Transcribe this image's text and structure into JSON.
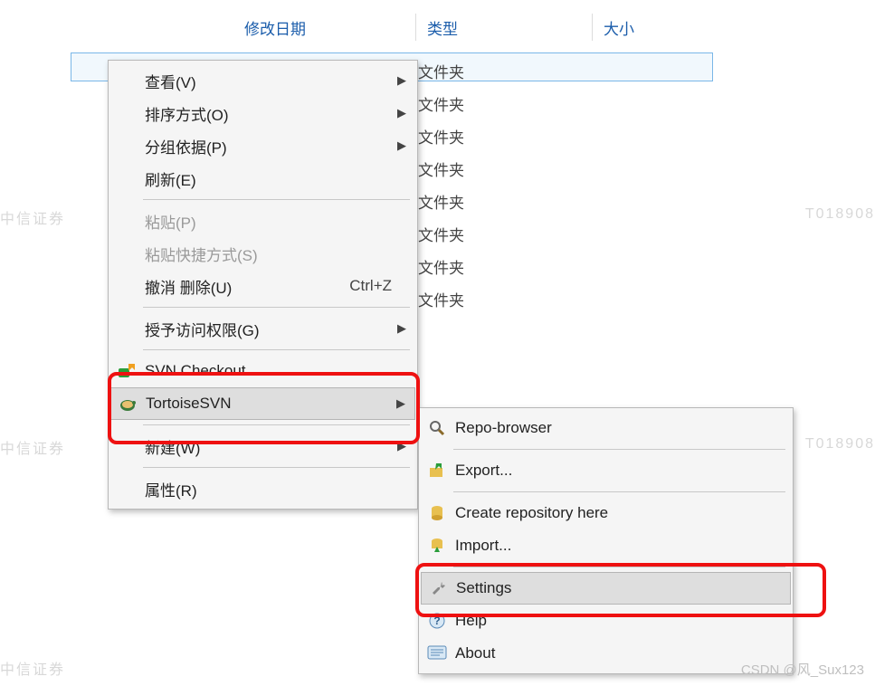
{
  "headers": {
    "date": "修改日期",
    "type": "类型",
    "size": "大小"
  },
  "rows": {
    "type_label": "文件夹",
    "count": 8
  },
  "menu1": {
    "view": "查看(V)",
    "sort": "排序方式(O)",
    "group": "分组依据(P)",
    "refresh": "刷新(E)",
    "paste": "粘贴(P)",
    "paste_shortcut": "粘贴快捷方式(S)",
    "undo_delete": "撤消 删除(U)",
    "undo_shortcut": "Ctrl+Z",
    "grant_access": "授予访问权限(G)",
    "svn_checkout": "SVN Checkout...",
    "tortoise": "TortoiseSVN",
    "new": "新建(W)",
    "properties": "属性(R)"
  },
  "menu2": {
    "repo_browser": "Repo-browser",
    "export": "Export...",
    "create_repo": "Create repository here",
    "import": "Import...",
    "settings": "Settings",
    "help": "Help",
    "about": "About"
  },
  "watermark": {
    "text": "中信证券",
    "id_text": "T018908"
  },
  "csdn": "CSDN @风_Sux123"
}
